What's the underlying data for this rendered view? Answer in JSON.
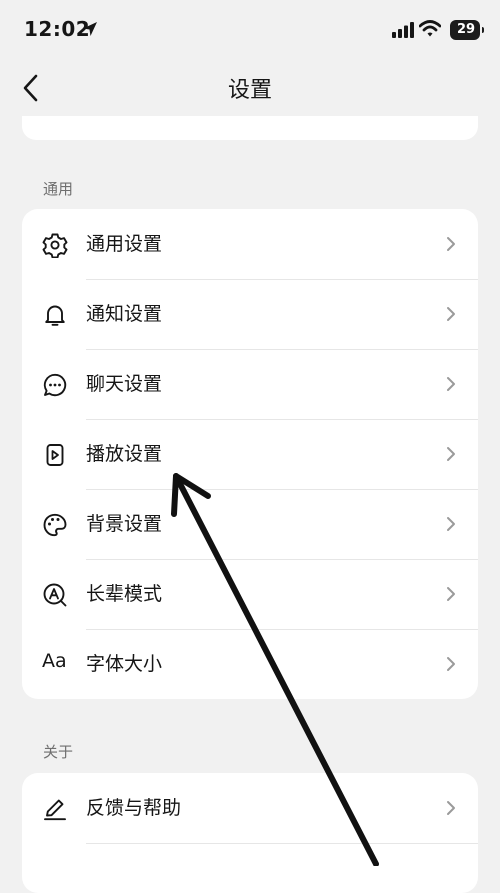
{
  "status_bar": {
    "time": "12:02",
    "battery": "29"
  },
  "header": {
    "title": "设置"
  },
  "sections": [
    {
      "label": "通用",
      "items": [
        {
          "label": "通用设置",
          "icon": "gear-icon"
        },
        {
          "label": "通知设置",
          "icon": "bell-icon"
        },
        {
          "label": "聊天设置",
          "icon": "chat-bubble-icon"
        },
        {
          "label": "播放设置",
          "icon": "play-icon"
        },
        {
          "label": "背景设置",
          "icon": "palette-icon"
        },
        {
          "label": "长辈模式",
          "icon": "elder-mode-icon"
        },
        {
          "label": "字体大小",
          "icon": "font-size-icon",
          "icon_text": "Aa"
        }
      ]
    },
    {
      "label": "关于",
      "items": [
        {
          "label": "反馈与帮助",
          "icon": "edit-pen-icon"
        }
      ]
    }
  ],
  "colors": {
    "background": "#f1f1f1",
    "card": "#ffffff",
    "text": "#161616",
    "muted": "#6f6f6f"
  }
}
